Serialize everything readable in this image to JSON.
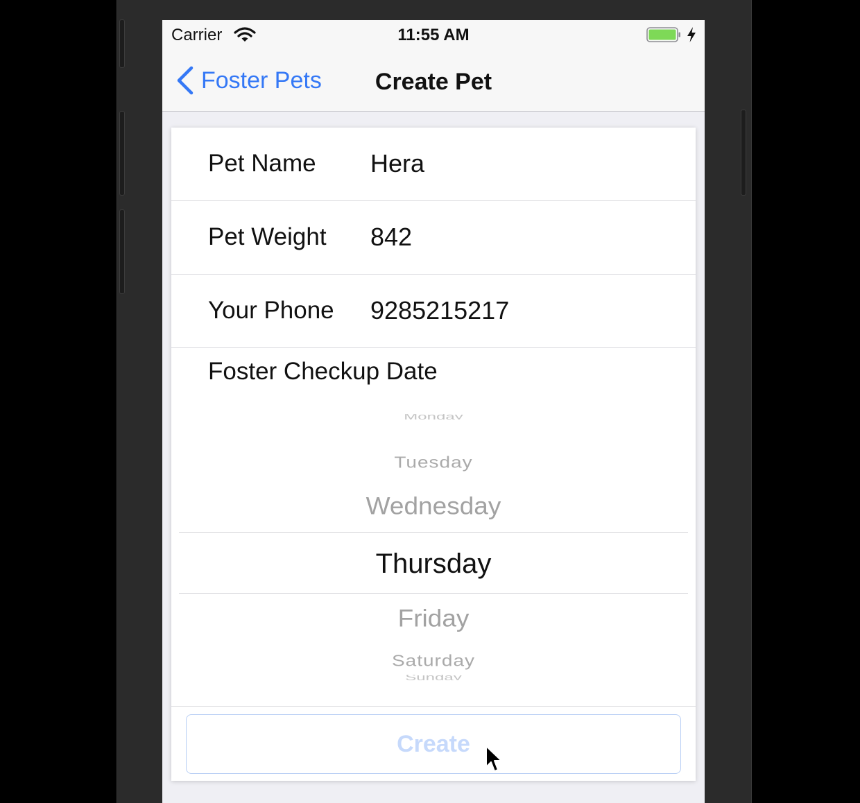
{
  "status_bar": {
    "carrier": "Carrier",
    "time": "11:55 AM",
    "icons": [
      "wifi-icon",
      "battery-icon",
      "charging-bolt-icon"
    ],
    "battery_color": "#7ed957"
  },
  "nav_bar": {
    "back_label": "Foster Pets",
    "title": "Create Pet",
    "tint_color": "#3478f6"
  },
  "form": {
    "fields": [
      {
        "label": "Pet Name",
        "value": "Hera"
      },
      {
        "label": "Pet Weight",
        "value": "842"
      },
      {
        "label": "Your Phone",
        "value": "9285215217"
      }
    ],
    "date_label": "Foster Checkup Date",
    "picker": {
      "items": [
        "Monday",
        "Tuesday",
        "Wednesday",
        "Thursday",
        "Friday",
        "Saturday",
        "Sunday"
      ],
      "selected": "Thursday"
    },
    "create_label": "Create"
  }
}
